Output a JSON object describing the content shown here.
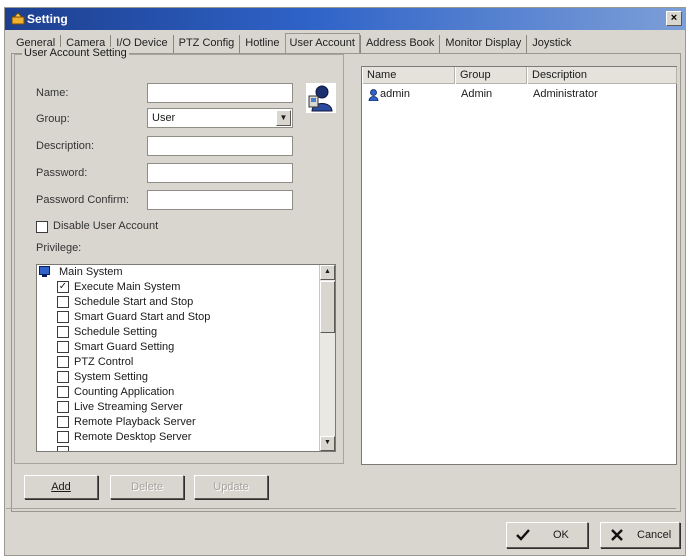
{
  "window": {
    "title": "Setting",
    "close_glyph": "×"
  },
  "tabs": [
    {
      "label": "General"
    },
    {
      "label": "Camera"
    },
    {
      "label": "I/O Device"
    },
    {
      "label": "PTZ Config"
    },
    {
      "label": "Hotline"
    },
    {
      "label": "User Account",
      "active": true
    },
    {
      "label": "Address Book"
    },
    {
      "label": "Monitor Display"
    },
    {
      "label": "Joystick"
    }
  ],
  "user_settings": {
    "legend": "User Account Setting",
    "name_label": "Name:",
    "name_value": "",
    "group_label": "Group:",
    "group_value": "User",
    "description_label": "Description:",
    "description_value": "",
    "password_label": "Password:",
    "password_value": "",
    "password_confirm_label": "Password Confirm:",
    "password_confirm_value": "",
    "disable_label": "Disable User Account",
    "disable_checked": false,
    "privilege_label": "Privilege:"
  },
  "privileges": {
    "root": "Main System",
    "items": [
      {
        "label": "Execute Main System",
        "checked": true
      },
      {
        "label": "Schedule Start and Stop",
        "checked": false
      },
      {
        "label": "Smart Guard Start and Stop",
        "checked": false
      },
      {
        "label": "Schedule Setting",
        "checked": false
      },
      {
        "label": "Smart Guard Setting",
        "checked": false
      },
      {
        "label": "PTZ Control",
        "checked": false
      },
      {
        "label": "System Setting",
        "checked": false
      },
      {
        "label": "Counting Application",
        "checked": false
      },
      {
        "label": "Live Streaming Server",
        "checked": false
      },
      {
        "label": "Remote Playback Server",
        "checked": false
      },
      {
        "label": "Remote Desktop Server",
        "checked": false
      }
    ]
  },
  "user_list": {
    "columns": [
      "Name",
      "Group",
      "Description"
    ],
    "rows": [
      {
        "name": "admin",
        "group": "Admin",
        "description": "Administrator"
      }
    ]
  },
  "actions": {
    "add": "Add",
    "delete": "Delete",
    "update": "Update"
  },
  "dialog_buttons": {
    "ok": "OK",
    "cancel": "Cancel"
  },
  "colors": {
    "titlebar_start": "#1d3f8f",
    "titlebar_end": "#7d9fd8",
    "window_bg": "#d8d6cf"
  }
}
